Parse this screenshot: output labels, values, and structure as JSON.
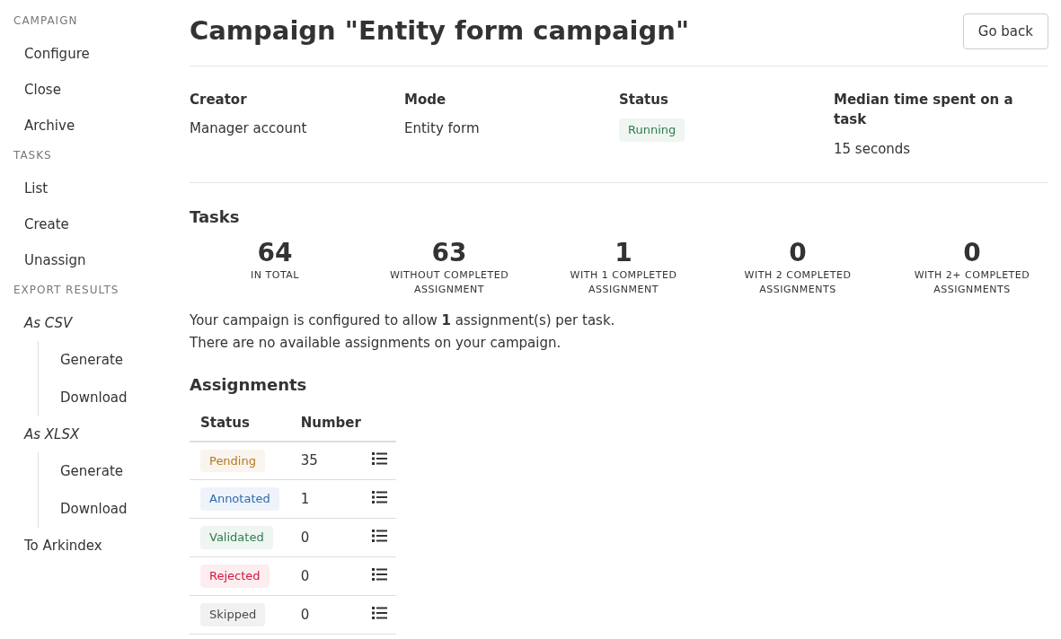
{
  "sidebar": {
    "sections": [
      {
        "heading": "CAMPAIGN",
        "items": [
          {
            "kind": "link",
            "label": "Configure"
          },
          {
            "kind": "link",
            "label": "Close"
          },
          {
            "kind": "link",
            "label": "Archive"
          }
        ]
      },
      {
        "heading": "TASKS",
        "items": [
          {
            "kind": "link",
            "label": "List"
          },
          {
            "kind": "link",
            "label": "Create"
          },
          {
            "kind": "link",
            "label": "Unassign"
          }
        ]
      },
      {
        "heading": "EXPORT RESULTS",
        "items": [
          {
            "kind": "group",
            "label": "As CSV",
            "children": [
              {
                "label": "Generate"
              },
              {
                "label": "Download"
              }
            ]
          },
          {
            "kind": "group",
            "label": "As XLSX",
            "children": [
              {
                "label": "Generate"
              },
              {
                "label": "Download"
              }
            ]
          },
          {
            "kind": "link",
            "label": "To Arkindex"
          }
        ]
      }
    ]
  },
  "title": "Campaign \"Entity form campaign\"",
  "back_button": "Go back",
  "details": [
    {
      "kind": "text",
      "label": "Creator",
      "value": "Manager account"
    },
    {
      "kind": "text",
      "label": "Mode",
      "value": "Entity form"
    },
    {
      "kind": "badge",
      "label": "Status",
      "value": "Running",
      "color": "#2e7d4f"
    },
    {
      "kind": "text",
      "label": "Median time spent on a task",
      "value": "15 seconds"
    }
  ],
  "tasks": {
    "heading": "Tasks",
    "stats": [
      {
        "value": "64",
        "label": "IN TOTAL"
      },
      {
        "value": "63",
        "label": "WITHOUT COMPLETED ASSIGNMENT"
      },
      {
        "value": "1",
        "label": "WITH 1 COMPLETED ASSIGNMENT"
      },
      {
        "value": "0",
        "label": "WITH 2 COMPLETED ASSIGNMENTS"
      },
      {
        "value": "0",
        "label": "WITH 2+ COMPLETED ASSIGNMENTS"
      }
    ],
    "notes": [
      "Your campaign is configured to allow **1** assignment(s) per task.",
      "There are no available assignments on your campaign."
    ]
  },
  "assignments": {
    "heading": "Assignments",
    "columns": [
      "Status",
      "Number"
    ],
    "rows": [
      {
        "status": "Pending",
        "color": "#b7791f",
        "number": "35"
      },
      {
        "status": "Annotated",
        "color": "#2b6cb0",
        "number": "1"
      },
      {
        "status": "Validated",
        "color": "#2e7d4f",
        "number": "0"
      },
      {
        "status": "Rejected",
        "color": "#d6163b",
        "number": "0"
      },
      {
        "status": "Skipped",
        "color": "#4a4a4a",
        "number": "0"
      }
    ]
  }
}
